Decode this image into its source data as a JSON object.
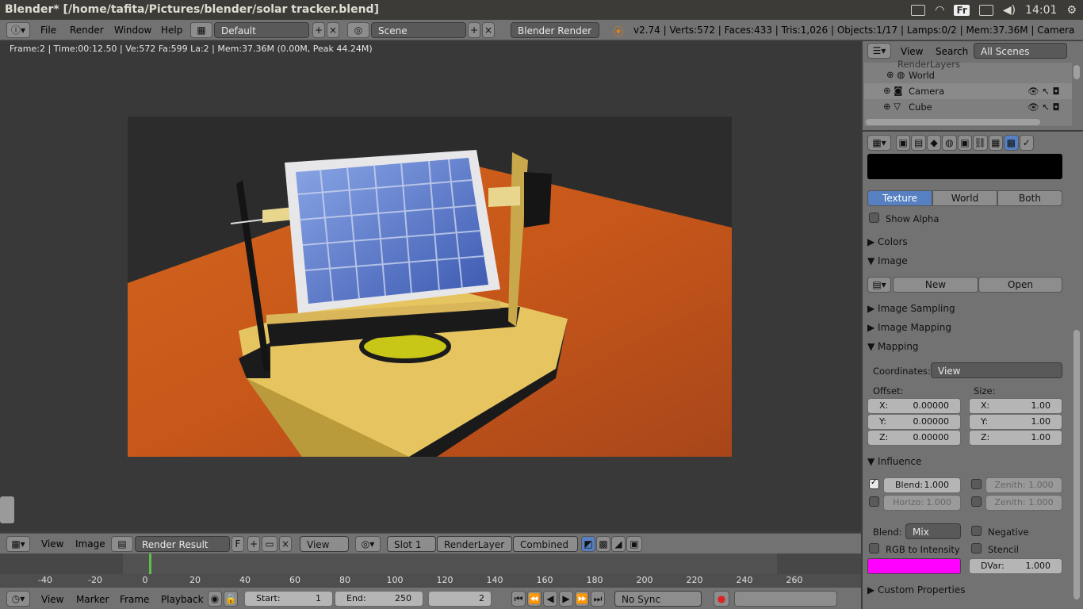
{
  "window": {
    "title": "Blender* [/home/tafita/Pictures/blender/solar tracker.blend]",
    "clock": "14:01",
    "kbd": "Fr"
  },
  "infobar": {
    "menus": [
      "File",
      "Render",
      "Window",
      "Help"
    ],
    "layout": "Default",
    "scene": "Scene",
    "engine": "Blender Render",
    "stats": "v2.74 | Verts:572 | Faces:433 | Tris:1,026 | Objects:1/17 | Lamps:0/2 | Mem:37.36M | Camera"
  },
  "viewport": {
    "info": "Frame:2 | Time:00:12.50 | Ve:572 Fa:599 La:2 | Mem:37.36M (0.00M, Peak 44.24M)"
  },
  "imagebar": {
    "view": "View",
    "image": "Image",
    "image_name": "Render Result",
    "f": "F",
    "view2": "View",
    "slot": "Slot 1",
    "layer": "RenderLayer",
    "pass": "Combined"
  },
  "timeline": {
    "ticks": [
      "-40",
      "-20",
      "0",
      "20",
      "40",
      "60",
      "80",
      "100",
      "120",
      "140",
      "160",
      "180",
      "200",
      "220",
      "240",
      "260"
    ]
  },
  "tlbar": {
    "view": "View",
    "marker": "Marker",
    "frame": "Frame",
    "playback": "Playback",
    "start_label": "Start:",
    "start": "1",
    "end_label": "End:",
    "end": "250",
    "current": "2",
    "sync": "No Sync"
  },
  "outliner": {
    "view": "View",
    "search": "Search",
    "filter": "All Scenes",
    "top": "RenderLayers",
    "items": [
      "World",
      "Camera",
      "Cube"
    ]
  },
  "props": {
    "tabs": [
      "Texture",
      "World",
      "Both"
    ],
    "show_alpha": "Show Alpha",
    "colors": "Colors",
    "image": "Image",
    "new": "New",
    "open": "Open",
    "sampling": "Image Sampling",
    "img_mapping": "Image Mapping",
    "mapping": "Mapping",
    "coords_label": "Coordinates:",
    "coords": "View",
    "offset": "Offset:",
    "size": "Size:",
    "ox": "X:",
    "oy": "Y:",
    "oz": "Z:",
    "ox_v": "0.00000",
    "oy_v": "0.00000",
    "oz_v": "0.00000",
    "sx_v": "1.00",
    "sy_v": "1.00",
    "sz_v": "1.00",
    "influence": "Influence",
    "blend_f": "Blend:",
    "blend_fv": "1.000",
    "zenith1": "Zenith: 1.000",
    "horizo": "Horizo: 1.000",
    "zenith2": "Zenith: 1.000",
    "blend_label": "Blend:",
    "blend_mode": "Mix",
    "negative": "Negative",
    "rgb": "RGB to Intensity",
    "stencil": "Stencil",
    "dvar": "DVar:",
    "dvar_v": "1.000",
    "custom": "Custom Properties",
    "magenta": "#ff00ff"
  }
}
